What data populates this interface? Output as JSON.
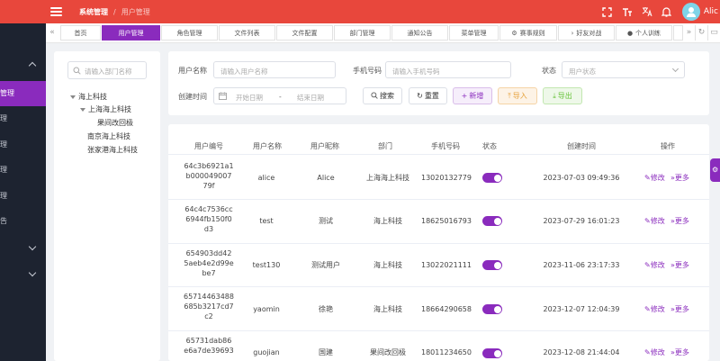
{
  "header": {
    "breadcrumb_system": "系统管理",
    "breadcrumb_separator": "/",
    "breadcrumb_current": "用户管理",
    "user_name": "Alic",
    "icons": [
      "fullscreen-icon",
      "font-size-icon",
      "translate-icon",
      "bell-icon",
      "avatar"
    ]
  },
  "sidebar": {
    "items": [
      {
        "label": "",
        "expandable": true
      },
      {
        "label": "管理",
        "active": true
      },
      {
        "label": "理"
      },
      {
        "label": "理"
      },
      {
        "label": "理"
      },
      {
        "label": "理"
      },
      {
        "label": "告"
      },
      {
        "label": "",
        "expandable": true
      },
      {
        "label": "",
        "expandable": true
      }
    ]
  },
  "tabs": [
    {
      "label": "首页"
    },
    {
      "label": "用户管理",
      "active": true
    },
    {
      "label": "角色管理"
    },
    {
      "label": "文件列表"
    },
    {
      "label": "文件配置"
    },
    {
      "label": "部门管理"
    },
    {
      "label": "通知公告"
    },
    {
      "label": "菜单管理"
    },
    {
      "label": "赛事规则"
    },
    {
      "label": "好友对战"
    },
    {
      "label": "个人训练"
    }
  ],
  "tree": {
    "search_placeholder": "请输入部门名称",
    "nodes": [
      {
        "label": "海上科技"
      },
      {
        "label": "上海海上科技"
      },
      {
        "label": "果间改回极"
      },
      {
        "label": "南京海上科技"
      },
      {
        "label": "张家港海上科技"
      }
    ]
  },
  "filters": {
    "username_label": "用户名称",
    "username_placeholder": "请输入用户名称",
    "phone_label": "手机号码",
    "phone_placeholder": "请输入手机号码",
    "status_label": "状态",
    "status_placeholder": "用户状态",
    "created_label": "创建时间",
    "start_placeholder": "开始日期",
    "range_sep": "-",
    "end_placeholder": "结束日期"
  },
  "actions": {
    "search": "搜索",
    "reset": "重置",
    "add": "新增",
    "import": "导入",
    "export": "导出"
  },
  "table": {
    "headers": [
      "用户编号",
      "用户名称",
      "用户昵称",
      "部门",
      "手机号码",
      "状态",
      "创建时间",
      "操作"
    ],
    "edit_label": "修改",
    "more_label": "更多",
    "rows": [
      {
        "id": [
          "64c3b6921a1",
          "b000049007",
          "79f"
        ],
        "username": "alice",
        "nickname": "Alice",
        "dept": "上海海上科技",
        "phone": "13020132779",
        "enabled": true,
        "created": "2023-07-03 09:49:36"
      },
      {
        "id": [
          "64c4c7536cc",
          "6944fb150f0",
          "d3"
        ],
        "username": "test",
        "nickname": "测试",
        "dept": "海上科技",
        "phone": "18625016793",
        "enabled": true,
        "created": "2023-07-29 16:01:23"
      },
      {
        "id": [
          "654903dd42",
          "5aeb4e2d99e",
          "be7"
        ],
        "username": "test130",
        "nickname": "测试用户",
        "dept": "海上科技",
        "phone": "13022021111",
        "enabled": true,
        "created": "2023-11-06 23:17:33"
      },
      {
        "id": [
          "65714463488",
          "685b3217cd7",
          "c2"
        ],
        "username": "yaomin",
        "nickname": "徐艳",
        "dept": "海上科技",
        "phone": "18664290658",
        "enabled": true,
        "created": "2023-12-07 12:04:39"
      },
      {
        "id": [
          "65731dab86",
          "e6a7de39693"
        ],
        "username": "guojian",
        "nickname": "国建",
        "dept": "果间改回极",
        "phone": "18011234650",
        "enabled": true,
        "created": "2023-12-08 21:44:04"
      }
    ]
  },
  "colors": {
    "topbar": "#e8473c",
    "accent": "#8a2bbd",
    "sidebar": "#1d2330"
  }
}
